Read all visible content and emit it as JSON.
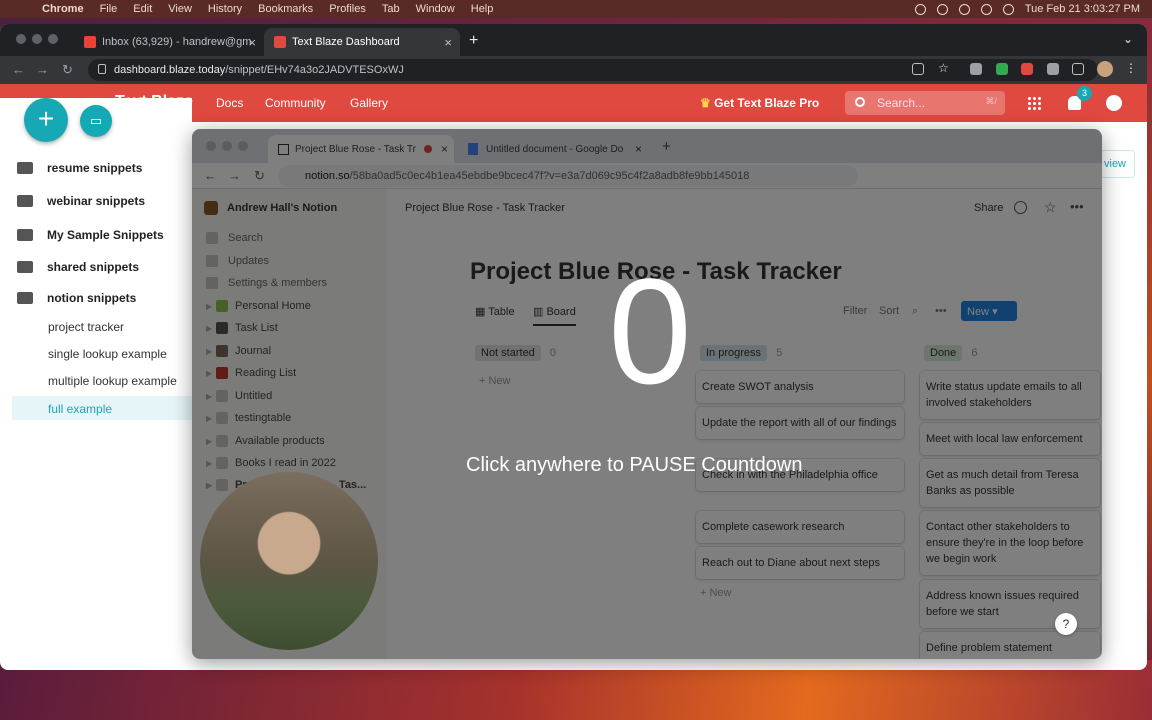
{
  "menubar": {
    "app": "Chrome",
    "items": [
      "File",
      "Edit",
      "View",
      "History",
      "Bookmarks",
      "Profiles",
      "Tab",
      "Window",
      "Help"
    ],
    "clock": "Tue Feb 21  3:03:27 PM"
  },
  "browser": {
    "tabs": [
      {
        "label": "Inbox (63,929) - handrew@gm"
      },
      {
        "label": "Text Blaze Dashboard"
      }
    ],
    "url_host": "dashboard.blaze.today",
    "url_path": "/snippet/EHv74a3o2JADVTESOxWJ"
  },
  "textblaze": {
    "logo": "Text Blaze",
    "nav": [
      "Docs",
      "Community",
      "Gallery"
    ],
    "pro": "Get Text Blaze Pro",
    "search_placeholder": "Search...",
    "search_kbd": "⌘/",
    "notifications": "3",
    "view_button": "view",
    "folders": [
      "resume snippets",
      "webinar snippets",
      "My Sample Snippets",
      "shared snippets",
      "notion snippets"
    ],
    "snippets": [
      "project tracker",
      "single lookup example",
      "multiple lookup example",
      "full example"
    ]
  },
  "inner_browser": {
    "tabs": [
      {
        "label": "Project Blue Rose - Task Tr"
      },
      {
        "label": "Untitled document - Google Do"
      }
    ],
    "url_host": "notion.so",
    "url_path": "/58ba0ad5c0ec4b1ea45ebdbe9bcec47f?v=e3a7d069c95c4f2a8adb8fe9bb145018"
  },
  "notion": {
    "workspace": "Andrew Hall's Notion",
    "nav": [
      "Search",
      "Updates",
      "Settings & members"
    ],
    "pages": [
      "Personal Home",
      "Task List",
      "Journal",
      "Reading List",
      "Untitled",
      "testingtable",
      "Available products",
      "Books I read in 2022",
      "Project Blue Rose - Tas..."
    ],
    "breadcrumb": "Project Blue Rose - Task Tracker",
    "share": "Share",
    "title": "Project Blue Rose - Task Tracker",
    "views": [
      "Table",
      "Board"
    ],
    "actions": [
      "Filter",
      "Sort"
    ],
    "new_button": "New",
    "columns": [
      {
        "name": "Not started",
        "count": "0",
        "color": "#e3e2e0"
      },
      {
        "name": "In progress",
        "count": "5",
        "color": "#d3e5ef"
      },
      {
        "name": "Done",
        "count": "6",
        "color": "#dbeddb"
      }
    ],
    "in_progress_cards": [
      "Create SWOT analysis",
      "Update the report with all of our findings",
      "Check in with the Philadelphia office",
      "Complete casework research",
      "Reach out to Diane about next steps"
    ],
    "done_cards": [
      "Write status update emails to all involved stakeholders",
      "Meet with local law enforcement",
      "Get as much detail from Teresa Banks as possible",
      "Contact other stakeholders to ensure they're in the loop before we begin work",
      "Address known issues required before we start",
      "Define problem statement"
    ],
    "new_label": "+ New"
  },
  "overlay": {
    "countdown": "0",
    "message": "Click anywhere to PAUSE Countdown"
  },
  "help": "?"
}
